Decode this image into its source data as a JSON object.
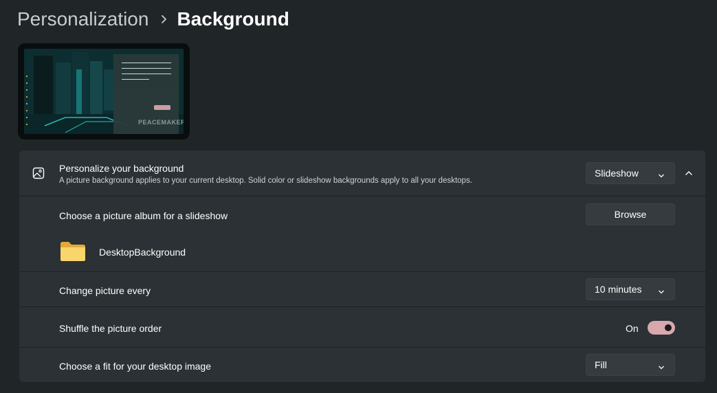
{
  "breadcrumb": {
    "parent": "Personalization",
    "current": "Background"
  },
  "preview": {
    "logo_text": "PEACEMAKER"
  },
  "personalize": {
    "title": "Personalize your background",
    "subtitle": "A picture background applies to your current desktop. Solid color or slideshow backgrounds apply to all your desktops.",
    "selected": "Slideshow",
    "icon": "image-icon"
  },
  "album": {
    "label": "Choose a picture album for a slideshow",
    "button": "Browse",
    "folder_name": "DesktopBackground",
    "folder_icon": "folder-icon"
  },
  "interval": {
    "label": "Change picture every",
    "selected": "10 minutes"
  },
  "shuffle": {
    "label": "Shuffle the picture order",
    "state": "On"
  },
  "fit": {
    "label": "Choose a fit for your desktop image",
    "selected": "Fill"
  },
  "colors": {
    "accent": "#d8a8ae",
    "card": "#2b3134",
    "background": "#202528"
  }
}
